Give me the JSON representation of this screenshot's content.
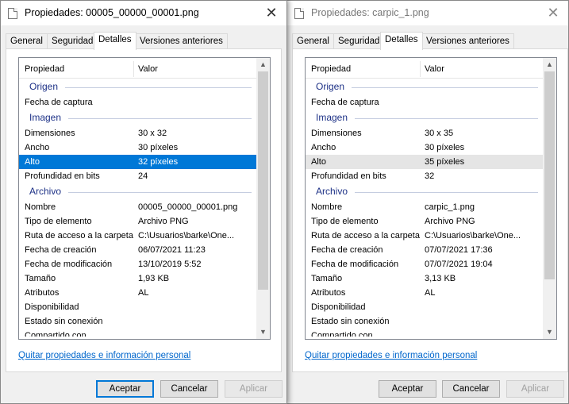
{
  "windows": [
    {
      "title": "Propiedades: 00005_00000_00001.png",
      "tabs": [
        "General",
        "Seguridad",
        "Detalles",
        "Versiones anteriores"
      ],
      "active_tab": "Detalles",
      "columns": {
        "property": "Propiedad",
        "value": "Valor"
      },
      "groups": {
        "origen": "Origen",
        "imagen": "Imagen",
        "archivo": "Archivo"
      },
      "rows": {
        "fecha_captura": {
          "k": "Fecha de captura",
          "v": ""
        },
        "dimensiones": {
          "k": "Dimensiones",
          "v": "30 x 32"
        },
        "ancho": {
          "k": "Ancho",
          "v": "30 píxeles"
        },
        "alto": {
          "k": "Alto",
          "v": "32 píxeles"
        },
        "profundidad": {
          "k": "Profundidad en bits",
          "v": "24"
        },
        "nombre": {
          "k": "Nombre",
          "v": "00005_00000_00001.png"
        },
        "tipo": {
          "k": "Tipo de elemento",
          "v": "Archivo PNG"
        },
        "ruta": {
          "k": "Ruta de acceso a la carpeta",
          "v": "C:\\Usuarios\\barke\\One..."
        },
        "creacion": {
          "k": "Fecha de creación",
          "v": "06/07/2021 11:23"
        },
        "modificacion": {
          "k": "Fecha de modificación",
          "v": "13/10/2019 5:52"
        },
        "tamano": {
          "k": "Tamaño",
          "v": "1,93 KB"
        },
        "atributos": {
          "k": "Atributos",
          "v": "AL"
        },
        "disponibilidad": {
          "k": "Disponibilidad",
          "v": ""
        },
        "sin_conexion": {
          "k": "Estado sin conexión",
          "v": ""
        },
        "compartido": {
          "k": "Compartido con",
          "v": ""
        }
      },
      "link": "Quitar propiedades e información personal",
      "buttons": {
        "ok": "Aceptar",
        "cancel": "Cancelar",
        "apply": "Aplicar"
      }
    },
    {
      "title": "Propiedades: carpic_1.png",
      "tabs": [
        "General",
        "Seguridad",
        "Detalles",
        "Versiones anteriores"
      ],
      "active_tab": "Detalles",
      "columns": {
        "property": "Propiedad",
        "value": "Valor"
      },
      "groups": {
        "origen": "Origen",
        "imagen": "Imagen",
        "archivo": "Archivo"
      },
      "rows": {
        "fecha_captura": {
          "k": "Fecha de captura",
          "v": ""
        },
        "dimensiones": {
          "k": "Dimensiones",
          "v": "30 x 35"
        },
        "ancho": {
          "k": "Ancho",
          "v": "30 píxeles"
        },
        "alto": {
          "k": "Alto",
          "v": "35 píxeles"
        },
        "profundidad": {
          "k": "Profundidad en bits",
          "v": "32"
        },
        "nombre": {
          "k": "Nombre",
          "v": "carpic_1.png"
        },
        "tipo": {
          "k": "Tipo de elemento",
          "v": "Archivo PNG"
        },
        "ruta": {
          "k": "Ruta de acceso a la carpeta",
          "v": "C:\\Usuarios\\barke\\One..."
        },
        "creacion": {
          "k": "Fecha de creación",
          "v": "07/07/2021 17:36"
        },
        "modificacion": {
          "k": "Fecha de modificación",
          "v": "07/07/2021 19:04"
        },
        "tamano": {
          "k": "Tamaño",
          "v": "3,13 KB"
        },
        "atributos": {
          "k": "Atributos",
          "v": "AL"
        },
        "disponibilidad": {
          "k": "Disponibilidad",
          "v": ""
        },
        "sin_conexion": {
          "k": "Estado sin conexión",
          "v": ""
        },
        "compartido": {
          "k": "Compartido con",
          "v": ""
        }
      },
      "link": "Quitar propiedades e información personal",
      "buttons": {
        "ok": "Aceptar",
        "cancel": "Cancelar",
        "apply": "Aplicar"
      }
    }
  ],
  "icons": {
    "close": "close-icon",
    "file": "file-icon",
    "scroll_up": "chevron-up-icon",
    "scroll_down": "chevron-down-icon"
  },
  "colors": {
    "selection": "#0078d7",
    "group_header": "#1e3287",
    "link": "#0066cc"
  }
}
